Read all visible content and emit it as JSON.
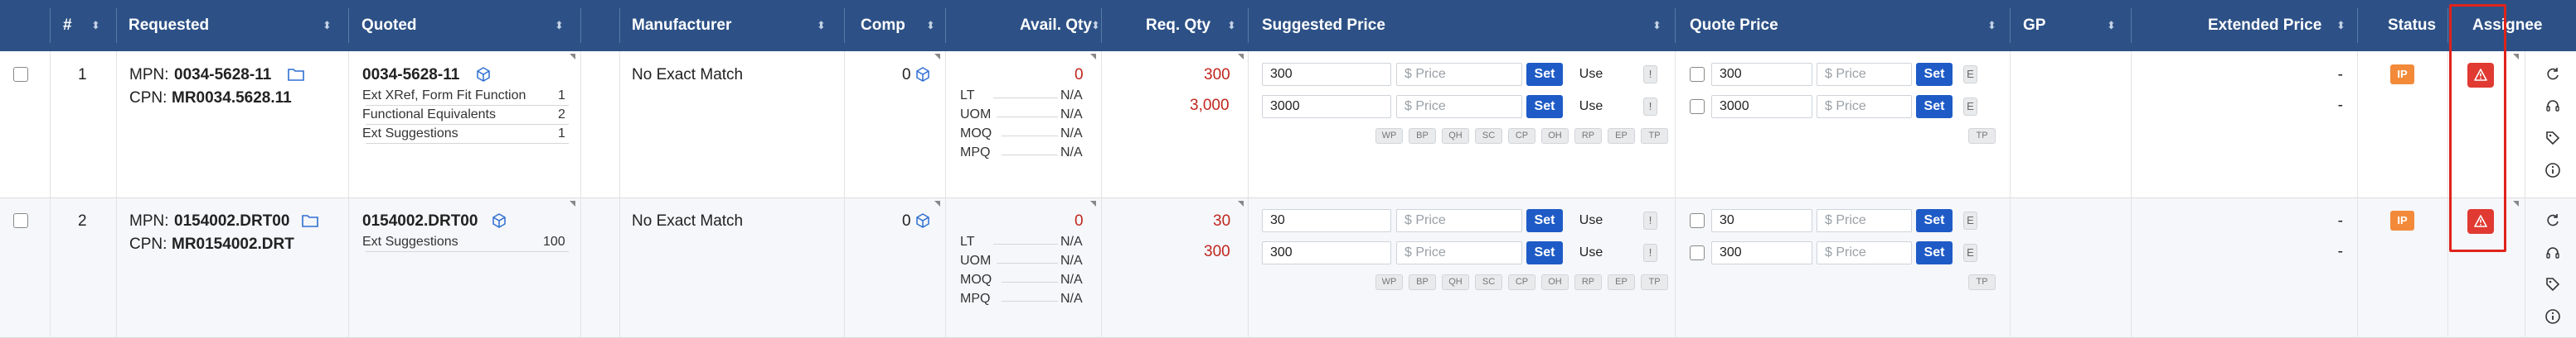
{
  "header": {
    "num": "#",
    "requested": "Requested",
    "quoted": "Quoted",
    "manufacturer": "Manufacturer",
    "comp": "Comp",
    "avail_qty": "Avail. Qty",
    "req_qty": "Req. Qty",
    "suggested_price": "Suggested Price",
    "quote_price": "Quote Price",
    "gp": "GP",
    "extended_price": "Extended Price",
    "status": "Status",
    "assignee": "Assignee"
  },
  "placeholders": {
    "price": "$ Price"
  },
  "labels": {
    "set": "Set",
    "use": "Use",
    "excl": "!",
    "e": "E",
    "tp": "TP",
    "mpn": "MPN:",
    "cpn": "CPN:",
    "dash": "-"
  },
  "mini_tags": [
    "WP",
    "BP",
    "QH",
    "SC",
    "CP",
    "OH",
    "RP",
    "EP",
    "TP"
  ],
  "avail_labels": [
    "LT",
    "UOM",
    "MOQ",
    "MPQ"
  ],
  "colors": {
    "header_bg": "#2d5186",
    "accent_blue": "#1e5bc6",
    "status_orange": "#f28a3a",
    "alert_red": "#e03a32",
    "value_red": "#c0261e"
  },
  "rows": [
    {
      "num": "1",
      "mpn": "0034-5628-11",
      "cpn": "MR0034.5628.11",
      "quoted_pn": "0034-5628-11",
      "quoted_items": [
        {
          "label": "Ext XRef, Form Fit Function",
          "count": "1"
        },
        {
          "label": "Functional Equivalents",
          "count": "2"
        },
        {
          "label": "Ext Suggestions",
          "count": "1"
        }
      ],
      "manufacturer": "No Exact Match",
      "comp": "0",
      "avail_qty": "0",
      "avail_values": [
        "N/A",
        "N/A",
        "N/A",
        "N/A"
      ],
      "req_qty": [
        "300",
        "3,000"
      ],
      "suggested_qty": [
        "300",
        "3000"
      ],
      "quote_qty": [
        "300",
        "3000"
      ],
      "extended": [
        "-",
        "-"
      ],
      "status": "IP"
    },
    {
      "num": "2",
      "mpn": "0154002.DRT00",
      "cpn": "MR0154002.DRT",
      "quoted_pn": "0154002.DRT00",
      "quoted_items": [
        {
          "label": "Ext Suggestions",
          "count": "100"
        }
      ],
      "manufacturer": "No Exact Match",
      "comp": "0",
      "avail_qty": "0",
      "avail_values": [
        "N/A",
        "N/A",
        "N/A",
        "N/A"
      ],
      "req_qty": [
        "30",
        "300"
      ],
      "suggested_qty": [
        "30",
        "300"
      ],
      "quote_qty": [
        "30",
        "300"
      ],
      "extended": [
        "-",
        "-"
      ],
      "status": "IP"
    }
  ],
  "side_icons": [
    "refresh-icon",
    "headset-icon",
    "tag-icon",
    "info-icon"
  ]
}
